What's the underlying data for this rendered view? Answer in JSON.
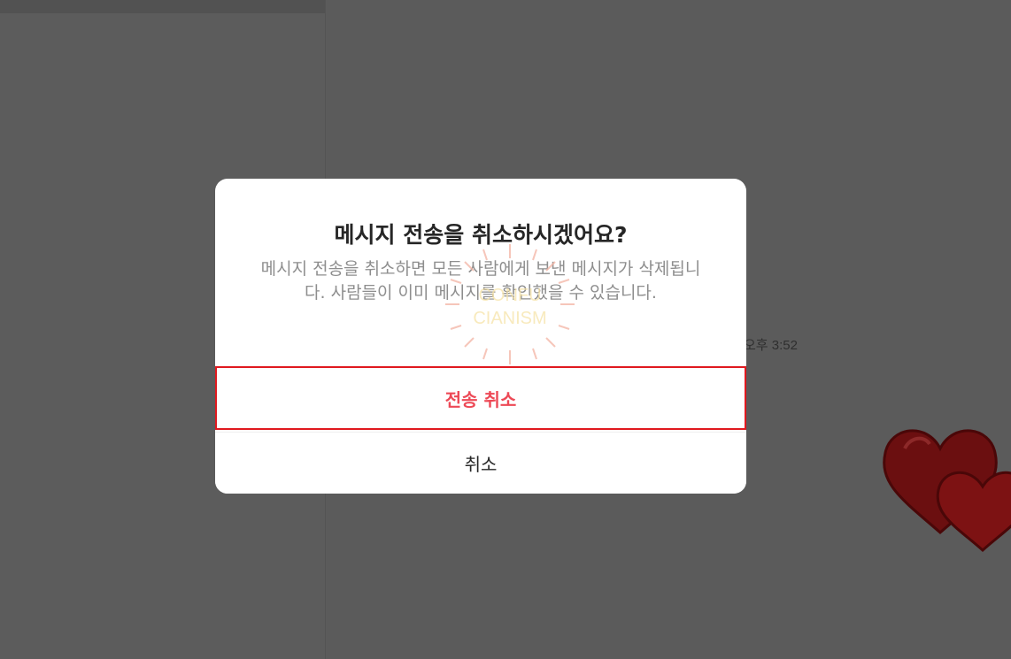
{
  "background": {
    "timestamp": "오후 3:52"
  },
  "dialog": {
    "title": "메시지 전송을 취소하시겠어요?",
    "message": "메시지 전송을 취소하면 모든 사람에게 보낸 메시지가 삭제됩니다. 사람들이 이미 메시지를 확인했을 수 있습니다.",
    "unsend_label": "전송 취소",
    "cancel_label": "취소",
    "accent_color": "#ed4956",
    "highlight_border_color": "#e0191f"
  },
  "watermark": {
    "line1": "CONFU",
    "line2": "CIANISM"
  },
  "decorations": {
    "hearts_icon": "hearts-sticker-icon"
  }
}
